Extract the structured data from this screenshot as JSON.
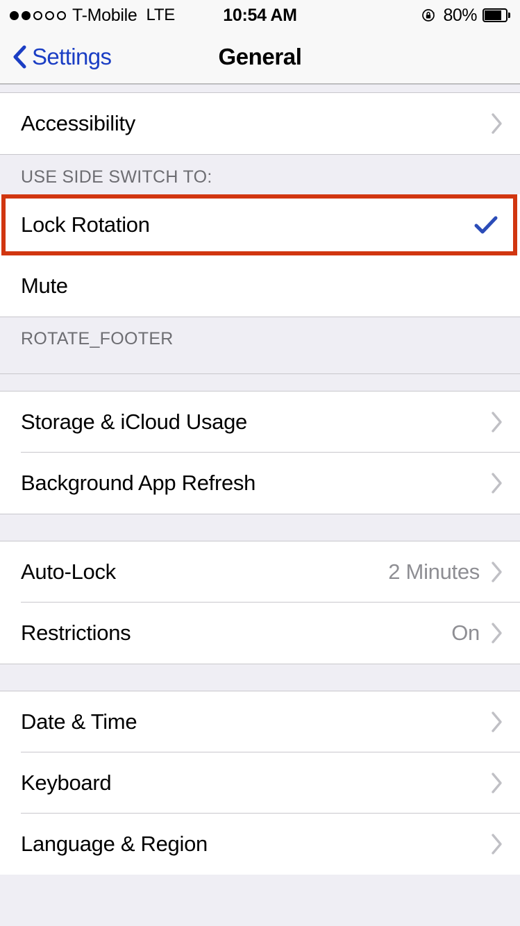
{
  "status_bar": {
    "signal_dots_filled": 2,
    "signal_dots_total": 5,
    "carrier": "T-Mobile",
    "network_type": "LTE",
    "time": "10:54 AM",
    "rotation_lock_icon": "rotation-lock-icon",
    "battery_percent": "80%",
    "battery_level": 80
  },
  "nav": {
    "back_label": "Settings",
    "back_icon": "chevron-left-icon",
    "title": "General"
  },
  "colors": {
    "accent_blue": "#1B3EC4",
    "checkmark_blue": "#2B4CB8",
    "highlight_red": "#D13610",
    "group_bg": "#EFEEF4",
    "row_bg": "#FFFFFF",
    "separator": "#C8C7CC",
    "value_gray": "#8E8E93",
    "header_gray": "#6D6D72",
    "chevron_gray": "#C0C0C5"
  },
  "sections": [
    {
      "id": "accessibility-section",
      "header": "",
      "footer": "",
      "rows": [
        {
          "name": "accessibility",
          "label": "Accessibility",
          "value": "",
          "accessory": "chevron",
          "highlighted": false
        }
      ]
    },
    {
      "id": "side-switch-section",
      "header": "USE SIDE SWITCH TO:",
      "footer": "ROTATE_FOOTER",
      "rows": [
        {
          "name": "lock-rotation",
          "label": "Lock Rotation",
          "value": "",
          "accessory": "check",
          "highlighted": true
        },
        {
          "name": "mute",
          "label": "Mute",
          "value": "",
          "accessory": "none",
          "highlighted": false
        }
      ]
    },
    {
      "id": "storage-section",
      "header": "",
      "footer": "",
      "rows": [
        {
          "name": "storage-icloud-usage",
          "label": "Storage & iCloud Usage",
          "value": "",
          "accessory": "chevron",
          "highlighted": false
        },
        {
          "name": "background-app-refresh",
          "label": "Background App Refresh",
          "value": "",
          "accessory": "chevron",
          "highlighted": false
        }
      ]
    },
    {
      "id": "lock-restrictions-section",
      "header": "",
      "footer": "",
      "rows": [
        {
          "name": "auto-lock",
          "label": "Auto-Lock",
          "value": "2 Minutes",
          "accessory": "chevron",
          "highlighted": false
        },
        {
          "name": "restrictions",
          "label": "Restrictions",
          "value": "On",
          "accessory": "chevron",
          "highlighted": false
        }
      ]
    },
    {
      "id": "locale-section",
      "header": "",
      "footer": "",
      "rows": [
        {
          "name": "date-time",
          "label": "Date & Time",
          "value": "",
          "accessory": "chevron",
          "highlighted": false
        },
        {
          "name": "keyboard",
          "label": "Keyboard",
          "value": "",
          "accessory": "chevron",
          "highlighted": false
        },
        {
          "name": "language-region",
          "label": "Language & Region",
          "value": "",
          "accessory": "chevron",
          "highlighted": false
        }
      ]
    }
  ]
}
